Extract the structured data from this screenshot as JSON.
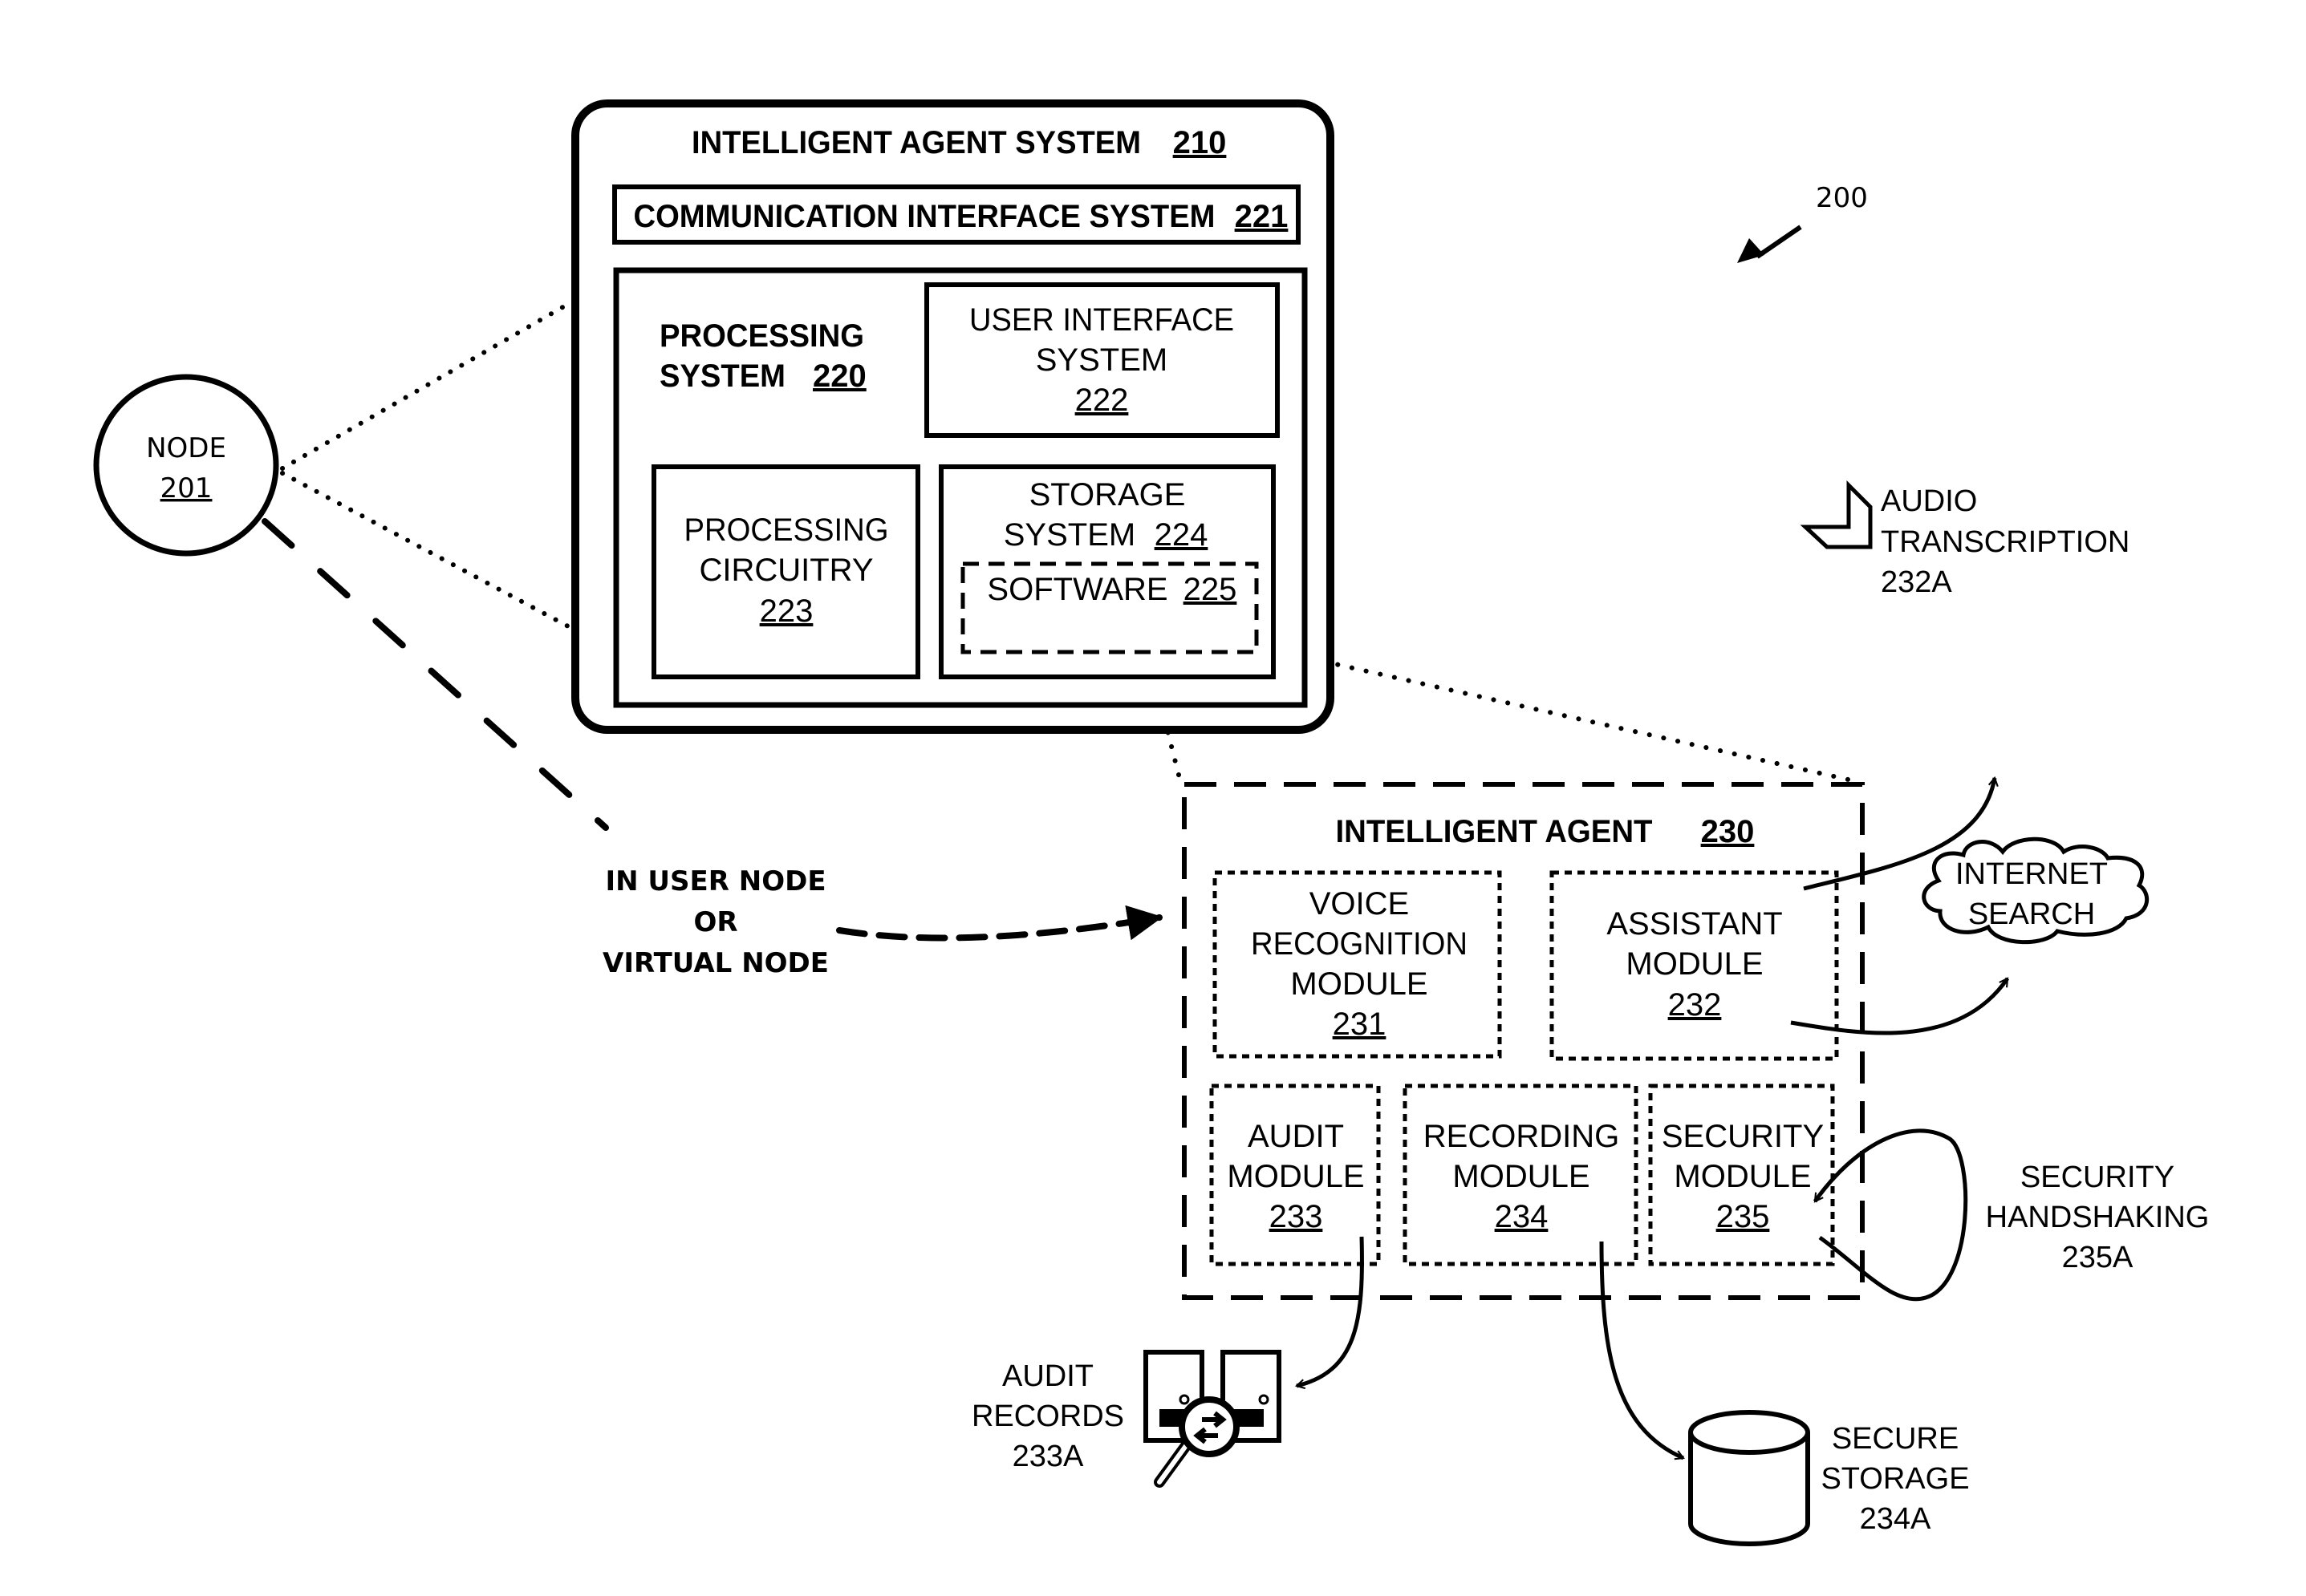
{
  "figure_ref": "200",
  "colors": {
    "ink": "#000000",
    "background": "#ffffff"
  },
  "node": {
    "label": "NODE",
    "ref": "201"
  },
  "connector_label": [
    "IN USER NODE",
    "OR",
    "VIRTUAL NODE"
  ],
  "intelligent_agent_system": {
    "title": "INTELLIGENT AGENT SYSTEM",
    "ref": "210",
    "communication_interface": {
      "label": "COMMUNICATION INTERFACE SYSTEM",
      "ref": "221"
    },
    "processing_system": {
      "label_lines": [
        "PROCESSING",
        "SYSTEM"
      ],
      "ref": "220",
      "user_interface": {
        "label_lines": [
          "USER INTERFACE",
          "SYSTEM"
        ],
        "ref": "222"
      },
      "processing_circuitry": {
        "label_lines": [
          "PROCESSING",
          "CIRCUITRY"
        ],
        "ref": "223"
      },
      "storage_system": {
        "label_lines": [
          "STORAGE",
          "SYSTEM"
        ],
        "ref": "224",
        "software": {
          "label": "SOFTWARE",
          "ref": "225"
        }
      }
    }
  },
  "intelligent_agent": {
    "title": "INTELLIGENT AGENT",
    "ref": "230",
    "modules": [
      {
        "id": "voice",
        "label_lines": [
          "VOICE",
          "RECOGNITION",
          "MODULE"
        ],
        "ref": "231"
      },
      {
        "id": "assistant",
        "label_lines": [
          "ASSISTANT",
          "MODULE"
        ],
        "ref": "232"
      },
      {
        "id": "audit",
        "label_lines": [
          "AUDIT",
          "MODULE"
        ],
        "ref": "233"
      },
      {
        "id": "recording",
        "label_lines": [
          "RECORDING",
          "MODULE"
        ],
        "ref": "234"
      },
      {
        "id": "security",
        "label_lines": [
          "SECURITY",
          "MODULE"
        ],
        "ref": "235"
      }
    ]
  },
  "externals": {
    "audio_transcription": {
      "label_lines": [
        "AUDIO",
        "TRANSCRIPTION",
        "232A"
      ],
      "icon": "document-fold-icon"
    },
    "internet_search": {
      "label_lines": [
        "INTERNET",
        "SEARCH"
      ],
      "icon": "cloud-icon"
    },
    "security_handshaking": {
      "label_lines": [
        "SECURITY",
        "HANDSHAKING",
        "235A"
      ]
    },
    "audit_records": {
      "label_lines": [
        "AUDIT",
        "RECORDS",
        "233A"
      ],
      "icon": "audit-records-magnifier-icon"
    },
    "secure_storage": {
      "label_lines": [
        "SECURE",
        "STORAGE",
        "234A"
      ],
      "icon": "database-cylinder-icon"
    }
  }
}
